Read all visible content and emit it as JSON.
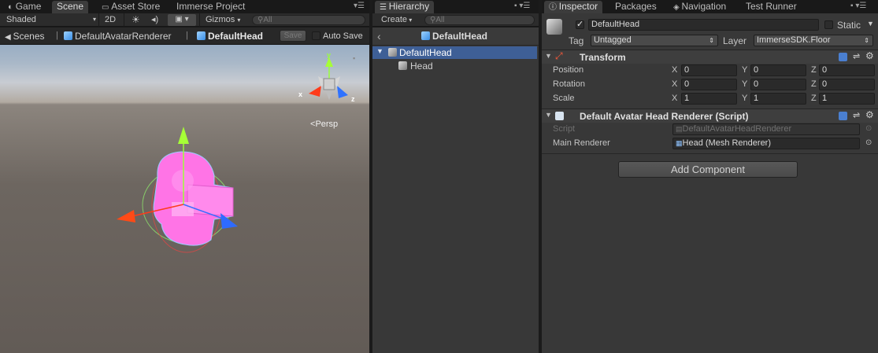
{
  "left_tabs": {
    "game": "Game",
    "scene": "Scene",
    "asset_store": "Asset Store",
    "immerse": "Immerse Project"
  },
  "scene_toolbar": {
    "shading": "Shaded",
    "mode_2d": "2D",
    "gizmos": "Gizmos",
    "search_placeholder": "All"
  },
  "scene_breadcrumb": {
    "scenes": "Scenes",
    "renderer": "DefaultAvatarRenderer",
    "current": "DefaultHead",
    "save": "Save",
    "auto_save": "Auto Save"
  },
  "scene_view": {
    "persp": "Persp",
    "axis_y": "y",
    "axis_x": "x",
    "axis_z": "z"
  },
  "hierarchy": {
    "tab": "Hierarchy",
    "create": "Create",
    "search_placeholder": "All",
    "header": "DefaultHead",
    "items": [
      {
        "label": "DefaultHead",
        "selected": true
      },
      {
        "label": "Head",
        "selected": false
      }
    ]
  },
  "right_tabs": {
    "inspector": "Inspector",
    "packages": "Packages",
    "navigation": "Navigation",
    "test_runner": "Test Runner"
  },
  "inspector": {
    "object_name": "DefaultHead",
    "static": "Static",
    "tag_label": "Tag",
    "tag_value": "Untagged",
    "layer_label": "Layer",
    "layer_value": "ImmerseSDK.Floor",
    "transform": {
      "title": "Transform",
      "position_label": "Position",
      "rotation_label": "Rotation",
      "scale_label": "Scale",
      "x": "X",
      "y": "Y",
      "z": "Z",
      "position": [
        "0",
        "0",
        "0"
      ],
      "rotation": [
        "0",
        "0",
        "0"
      ],
      "scale": [
        "1",
        "1",
        "1"
      ]
    },
    "script_component": {
      "title": "Default Avatar Head Renderer (Script)",
      "script_label": "Script",
      "script_value": "DefaultAvatarHeadRenderer",
      "main_renderer_label": "Main Renderer",
      "main_renderer_value": "Head (Mesh Renderer)"
    },
    "add_component": "Add Component"
  },
  "colors": {
    "accent_selection": "#3e5f96",
    "head_pink": "#ff6fe0"
  }
}
